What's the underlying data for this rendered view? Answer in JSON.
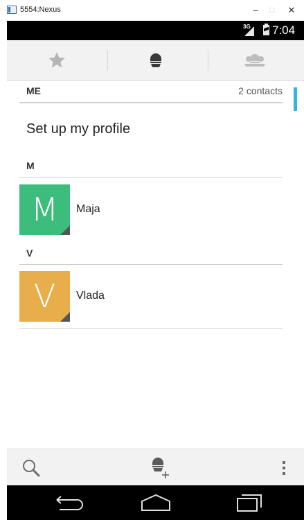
{
  "window": {
    "title": "5554:Nexus",
    "minimize": "–",
    "maximize": "□",
    "close": "✕"
  },
  "status_bar": {
    "network_label": "3G",
    "time": "7:04"
  },
  "tabs": [
    {
      "name": "favorites",
      "icon": "star-icon"
    },
    {
      "name": "all-contacts",
      "icon": "person-icon",
      "selected": true
    },
    {
      "name": "groups",
      "icon": "group-icon"
    }
  ],
  "me_section": {
    "header": "ME",
    "count": "2 contacts",
    "profile": "Set up my profile"
  },
  "groups": [
    {
      "letter": "M",
      "contact": {
        "name": "Maja",
        "initial": "M",
        "color": "#3dbd7b"
      }
    },
    {
      "letter": "V",
      "contact": {
        "name": "Vlada",
        "initial": "V",
        "color": "#e9ae4c"
      }
    }
  ],
  "colors": {
    "accent": "#33b5e5",
    "tab_bar": "#f2f2f2"
  },
  "action_bar": {
    "icons": [
      "search-icon",
      "add-contact-icon",
      "overflow-menu-icon"
    ]
  },
  "nav_bar": {
    "icons": [
      "back-icon",
      "home-icon",
      "recent-apps-icon"
    ]
  }
}
